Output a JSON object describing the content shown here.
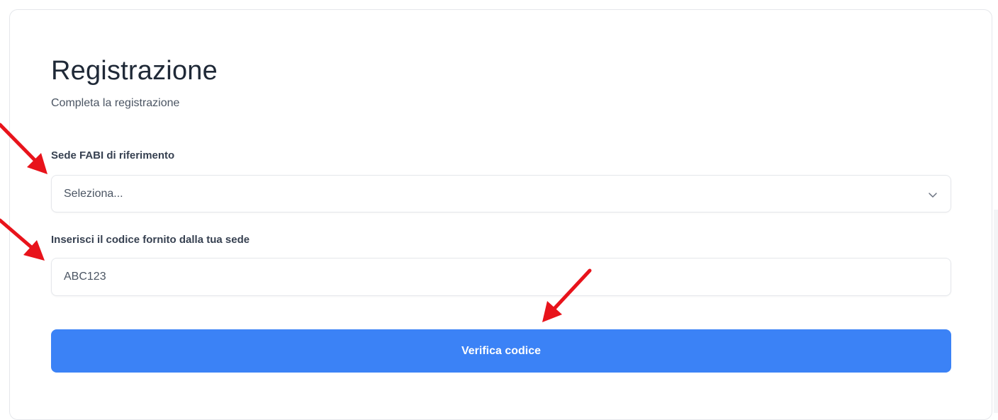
{
  "page": {
    "title": "Registrazione",
    "subtitle": "Completa la registrazione"
  },
  "form": {
    "sede_label": "Sede FABI di riferimento",
    "sede_select": {
      "selected": "Seleziona...",
      "icon": "chevron-down-icon"
    },
    "codice_label": "Inserisci il codice fornito dalla tua sede",
    "codice_input": {
      "value": "ABC123"
    },
    "submit_label": "Verifica codice"
  },
  "annotations": {
    "arrow_color": "#e8131b",
    "arrow_targets": [
      "sede-select",
      "codice-input",
      "verify-button"
    ]
  },
  "colors": {
    "primary": "#3b82f6",
    "heading": "#1f2937",
    "muted_text": "#4b5563",
    "border": "#e5e7eb"
  }
}
